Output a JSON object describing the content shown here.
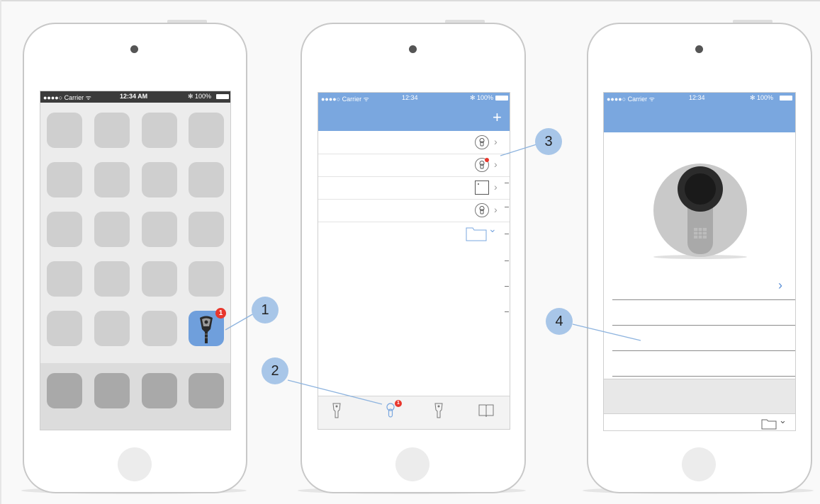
{
  "status_bar": {
    "phone1": {
      "carrier": "●●●●○ Carrier ᯤ",
      "time": "12:34 AM",
      "battery": "✻ 100%"
    },
    "phone2": {
      "carrier": "●●●●○ Carrier ᯤ",
      "time": "12:34",
      "battery": "✻ 100%"
    },
    "phone3": {
      "carrier": "●●●●○ Carrier ᯤ",
      "time": "12:34",
      "battery": "✻ 100%"
    }
  },
  "app_badge": "1",
  "toolbar": {
    "add_label": "+"
  },
  "list_chevron": "›",
  "folder_chevron": "⌄",
  "tab_badge": "1",
  "detail_chevron": "›",
  "callouts": [
    "1",
    "2",
    "3",
    "4"
  ],
  "colors": {
    "accent": "#7aa7df",
    "badge": "#e8362c",
    "callout": "#a8c6e8"
  },
  "icons": {
    "list_rows": [
      "lock-cylinder-icon",
      "lock-cylinder-icon",
      "door-frame-icon",
      "lock-cylinder-icon",
      "folder-icon"
    ],
    "tabs": [
      "key-icon",
      "lock-cylinder-icon",
      "key-icon",
      "book-icon"
    ]
  }
}
